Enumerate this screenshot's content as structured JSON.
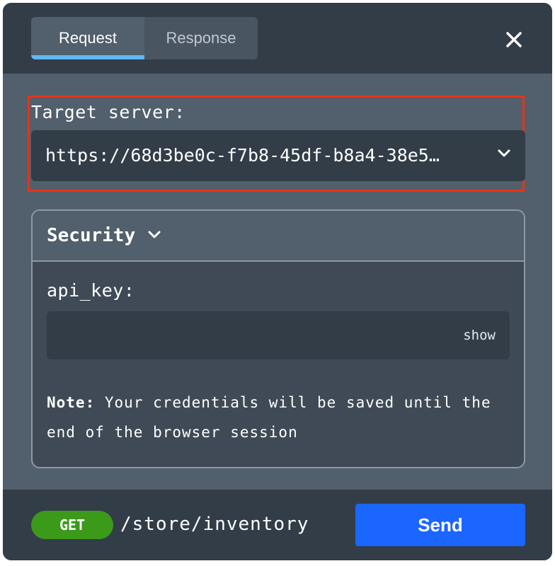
{
  "tabs": [
    {
      "label": "Request",
      "active": true
    },
    {
      "label": "Response",
      "active": false
    }
  ],
  "close_icon": "close-icon",
  "target_server": {
    "label": "Target server:",
    "value": "https://68d3be0c-f7b8-45df-b8a4-38e5…",
    "icon": "chevron-down-icon"
  },
  "security": {
    "title": "Security",
    "icon": "chevron-down-icon",
    "api_key_label": "api_key:",
    "api_key_value": "",
    "show_label": "show",
    "note_strong": "Note:",
    "note_text": " Your credentials will be saved until the end of the browser session"
  },
  "footer": {
    "method": "GET",
    "path": "/store/inventory",
    "send_label": "Send"
  },
  "colors": {
    "header_bg": "#323d48",
    "panel_bg": "#525f6c",
    "tab_indicator": "#5fb8f6",
    "highlight_border": "#e83217",
    "get_badge": "#3c9a1a",
    "send_button": "#1a66ff"
  }
}
